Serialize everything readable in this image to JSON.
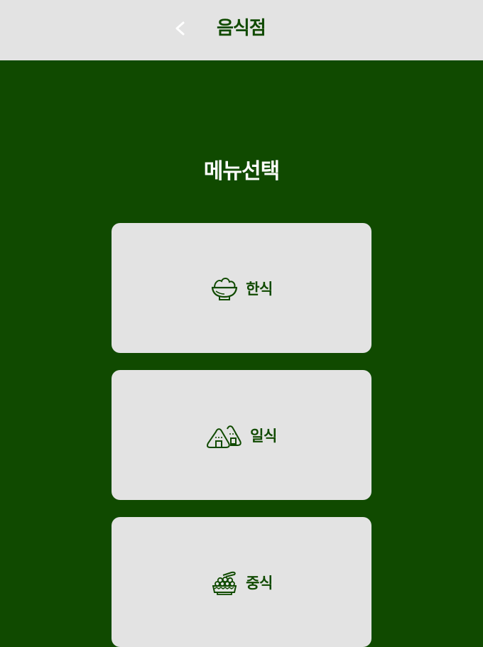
{
  "header": {
    "back_label": "<",
    "title": "음식점"
  },
  "main": {
    "section_title": "메뉴선택",
    "menu_items": [
      {
        "label": "한식",
        "icon": "rice-bowl-icon"
      },
      {
        "label": "일식",
        "icon": "onigiri-icon"
      },
      {
        "label": "중식",
        "icon": "dumpling-bowl-icon"
      }
    ]
  },
  "colors": {
    "primary": "#104a00",
    "header_bg": "#e3e3e3",
    "card_bg": "#e3e3e3",
    "title_text": "#ffffff"
  }
}
